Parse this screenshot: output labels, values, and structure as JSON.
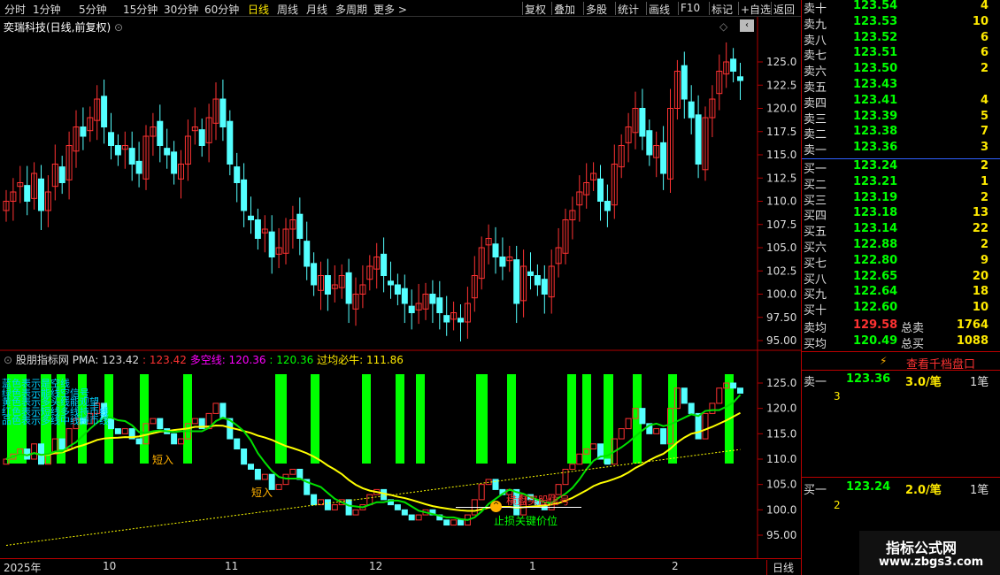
{
  "toolbar": {
    "periods": [
      "分时",
      "1分钟",
      "5分钟",
      "15分钟",
      "30分钟",
      "60分钟",
      "日线",
      "周线",
      "月线",
      "多周期",
      "更多 >"
    ],
    "actions": [
      "复权",
      "叠加",
      "多股",
      "统计",
      "画线",
      "F10",
      "标记",
      "+自选",
      "返回"
    ]
  },
  "stock_title": "奕瑞科技(日线,前复权)",
  "price_axis": [
    "125.0",
    "122.5",
    "120.0",
    "117.5",
    "115.0",
    "112.5",
    "110.0",
    "107.5",
    "105.0",
    "102.5",
    "100.0",
    "97.50",
    "95.00"
  ],
  "ind_axis": [
    "125.0",
    "120.0",
    "115.0",
    "110.0",
    "105.0",
    "100.0",
    "95.00"
  ],
  "indicator": {
    "name": "股朋指标网",
    "pma_label": "PMA: 123.42",
    "v2": ": 123.42",
    "dk_label": "多空线",
    "dk_val": ": 120.36",
    "v4": ": 120.36",
    "gj_label": "过均必牛",
    "gj_val": ": 111.86"
  },
  "legend_lines": [
    "蓝色表示是空线",
    "绿色表示能线空信号",
    "黄色表示多头线能观望",
    "红色表示短线多线持币线",
    "品色表示多线中线持币线"
  ],
  "annotations": {
    "short1": "短入",
    "short2": "短入",
    "buy": "横盘买股信号",
    "stop": "止损关键价位"
  },
  "xaxis": {
    "labels": [
      "2025年",
      "10",
      "11",
      "12",
      "1",
      "2"
    ],
    "period": "日线"
  },
  "orderbook": {
    "asks": [
      {
        "l": "卖十",
        "p": "123.54",
        "v": "4"
      },
      {
        "l": "卖九",
        "p": "123.53",
        "v": "10"
      },
      {
        "l": "卖八",
        "p": "123.52",
        "v": "6"
      },
      {
        "l": "卖七",
        "p": "123.51",
        "v": "6"
      },
      {
        "l": "卖六",
        "p": "123.50",
        "v": "2"
      },
      {
        "l": "卖五",
        "p": "123.43",
        "v": ""
      },
      {
        "l": "卖四",
        "p": "123.41",
        "v": "4"
      },
      {
        "l": "卖三",
        "p": "123.39",
        "v": "5"
      },
      {
        "l": "卖二",
        "p": "123.38",
        "v": "7"
      },
      {
        "l": "卖一",
        "p": "123.36",
        "v": "3"
      }
    ],
    "bids": [
      {
        "l": "买一",
        "p": "123.24",
        "v": "2"
      },
      {
        "l": "买二",
        "p": "123.21",
        "v": "1"
      },
      {
        "l": "买三",
        "p": "123.19",
        "v": "2"
      },
      {
        "l": "买四",
        "p": "123.18",
        "v": "13"
      },
      {
        "l": "买五",
        "p": "123.14",
        "v": "22"
      },
      {
        "l": "买六",
        "p": "122.88",
        "v": "2"
      },
      {
        "l": "买七",
        "p": "122.80",
        "v": "9"
      },
      {
        "l": "买八",
        "p": "122.65",
        "v": "20"
      },
      {
        "l": "买九",
        "p": "122.64",
        "v": "18"
      },
      {
        "l": "买十",
        "p": "122.60",
        "v": "10"
      }
    ],
    "avg_sell": {
      "l": "卖均",
      "p": "129.58",
      "t": "总卖",
      "v": "1764"
    },
    "avg_buy": {
      "l": "买均",
      "p": "120.49",
      "t": "总买",
      "v": "1088"
    }
  },
  "l2": {
    "btn": "查看千档盘口",
    "ask1": {
      "l": "卖一",
      "p": "123.36",
      "q": "3.0/笔",
      "n": "1笔",
      "sub": "3"
    },
    "bid1": {
      "l": "买一",
      "p": "123.24",
      "q": "2.0/笔",
      "n": "1笔",
      "sub": "2"
    }
  },
  "watermark": {
    "line1": "指标公式网",
    "line2": "www.zbgs3.com"
  },
  "colors": {
    "up": "#ff3232",
    "down": "#54ffff",
    "ma": "#ffff00",
    "grid": "#b00000",
    "green": "#00ff00"
  }
}
